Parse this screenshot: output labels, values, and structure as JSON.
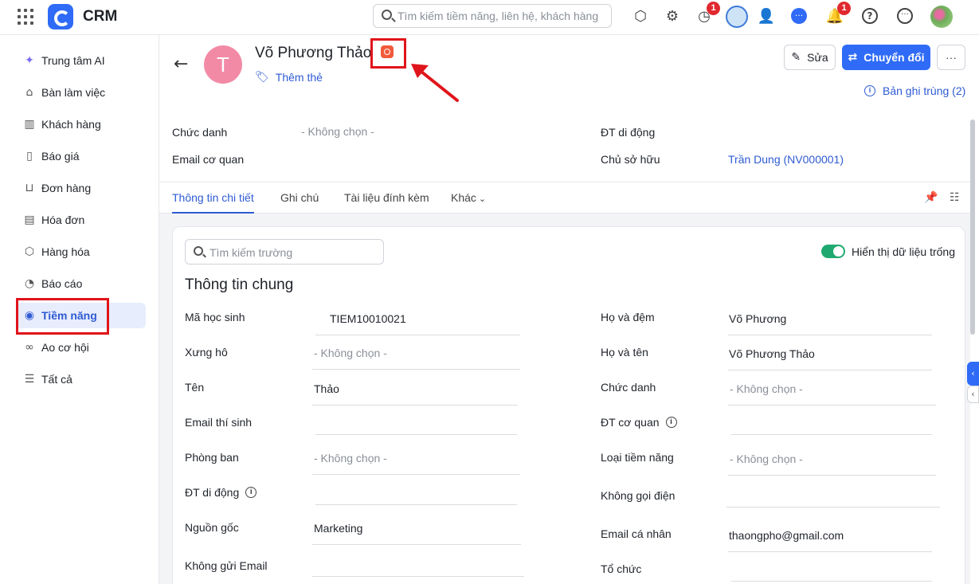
{
  "app": {
    "brand": "CRM",
    "search_placeholder": "Tìm kiếm tiềm năng, liên hệ, khách hàng"
  },
  "topbar": {
    "icons": [
      "cube-search-icon",
      "gear-icon",
      "timer-icon",
      "assistant-avatar-icon",
      "add-user-icon",
      "chat-icon",
      "bell-icon",
      "help-icon",
      "more-circle-icon",
      "user-avatar"
    ],
    "timer_badge": "1",
    "bell_badge": "1"
  },
  "sidebar": {
    "items": [
      {
        "label": "Trung tâm AI",
        "icon": "sparkle-icon"
      },
      {
        "label": "Bàn làm việc",
        "icon": "home-icon"
      },
      {
        "label": "Khách hàng",
        "icon": "building-icon"
      },
      {
        "label": "Báo giá",
        "icon": "quote-doc-icon"
      },
      {
        "label": "Đơn hàng",
        "icon": "cart-icon"
      },
      {
        "label": "Hóa đơn",
        "icon": "invoice-icon"
      },
      {
        "label": "Hàng hóa",
        "icon": "box-icon"
      },
      {
        "label": "Báo cáo",
        "icon": "pie-chart-icon"
      },
      {
        "label": "Tiềm năng",
        "icon": "lead-icon",
        "active": true
      },
      {
        "label": "Ao cơ hội",
        "icon": "opportunity-icon"
      },
      {
        "label": "Tất cả",
        "icon": "list-icon"
      }
    ]
  },
  "record": {
    "avatar_letter": "T",
    "name": "Võ Phương Thảo",
    "add_tag": "Thêm thẻ",
    "edit_button": "Sửa",
    "convert_button": "Chuyển đổi",
    "more_button": "···",
    "duplicate_link": "Bản ghi trùng (2)",
    "summary": {
      "title_label": "Chức danh",
      "title_value": "- Không chọn -",
      "work_email_label": "Email cơ quan",
      "work_email_value": "",
      "mobile_label": "ĐT di động",
      "mobile_value": "",
      "owner_label": "Chủ sở hữu",
      "owner_value": "Trần Dung (NV000001)"
    }
  },
  "tabs": [
    "Thông tin chi tiết",
    "Ghi chú",
    "Tài liệu đính kèm",
    "Khác"
  ],
  "detail": {
    "search_placeholder": "Tìm kiếm trường",
    "show_empty_label": "Hiển thị dữ liệu trống",
    "show_empty_on": true,
    "section_title": "Thông tin chung",
    "left_fields": [
      {
        "label": "Mã học sinh",
        "value": "TIEM10010021"
      },
      {
        "label": "Xưng hô",
        "value": "- Không chọn -"
      },
      {
        "label": "Tên",
        "value": "Thảo"
      },
      {
        "label": "Email thí sinh",
        "value": ""
      },
      {
        "label": "Phòng ban",
        "value": "- Không chọn -"
      },
      {
        "label": "ĐT di động",
        "value": ""
      },
      {
        "label": "Nguồn gốc",
        "value": "Marketing"
      },
      {
        "label": "Không gửi Email",
        "value": ""
      }
    ],
    "right_fields": [
      {
        "label": "Họ và đệm",
        "value": "Võ Phương"
      },
      {
        "label": "Họ và tên",
        "value": "Võ Phương Thảo"
      },
      {
        "label": "Chức danh",
        "value": "- Không chọn -"
      },
      {
        "label": "ĐT cơ quan",
        "value": ""
      },
      {
        "label": "Loại tiềm năng",
        "value": "- Không chọn -"
      },
      {
        "label": "Không gọi điện",
        "value": ""
      },
      {
        "label": "Email cá nhân",
        "value": "thaongpho@gmail.com"
      },
      {
        "label": "Tổ chức",
        "value": ""
      }
    ]
  },
  "colors": {
    "accent": "#2f6bf6",
    "highlight": "#e0141b",
    "toggle": "#1fa971",
    "avatar": "#f28aa6"
  }
}
